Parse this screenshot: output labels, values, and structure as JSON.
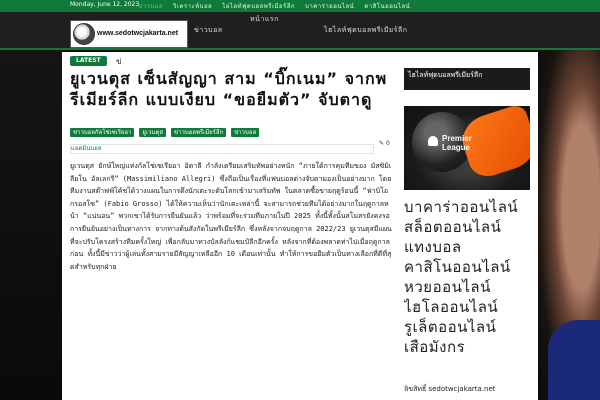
{
  "topbar": {
    "date": "Monday, June 12, 2023",
    "nav": [
      "ข่าวบอล",
      "วิเคราะห์บอล",
      "ไฮไลท์ฟุตบอลพรีเมียร์ลีก",
      "บาคาร่าออนไลน์",
      "คาสิโนออนไลน์"
    ]
  },
  "header": {
    "logo_text": "www.sedotwcjakarta.net",
    "menu": [
      "หน้าแรก",
      "ข่าวบอล",
      "ไฮไลท์ฟุตบอลพรีเมียร์ลีก"
    ]
  },
  "article": {
    "latest_label": "LATEST",
    "latest_text": "ข่",
    "title": "ยูเวนตุส เซ็นสัญญา สาม “บิ๊กเนม” จากพรีเมียร์ลีก แบบเงียบ “ขอยืมตัว” จับตาดู",
    "tags": [
      "ข่าวบอลกัลโช่เซเรียอา",
      "ยูเวนตุส",
      "ข่าวบอลพรีเมียร์ลีก",
      "ข่าวบอล"
    ],
    "author": "แอดมินบอล",
    "comments": "0",
    "body": "ยูเวนตุส ยักษ์ใหญ่แห่งกัลโช่เซเรียอา อิตาลี กำลังเตรียมเสริมทัพอย่างหนัก “ภายใต้การคุมทีมของ มัสซิมิเลียโน อัลเลกรี” (Massimiliano Allegri) ซึ่งถือเป็นเรื่องที่แฟนบอลต่างจับตามองเป็นอย่างมาก โดยทีมงานสต๊าฟฟ์โค้ชได้วางแผนในการดึงนักเตะระดับโลกเข้ามาเสริมทัพ ในตลาดซื้อขายฤดูร้อนนี้ “ฟาบิโอ กรอสโซ” (Fabio Grosso) ได้ให้ความเห็นว่านักเตะเหล่านี้ จะสามารถช่วยทีมได้อย่างมากในฤดูกาลหน้า “แน่นอน” พวกเขาได้รับการยืนยันแล้ว ว่าพร้อมที่จะร่วมทีมภายในปี 2025 ทั้งนี้ทั้งนั้นสโมสรยังคงรอการยืนยันอย่างเป็นทางการ จากทางต้นสังกัดในพรีเมียร์ลีก ซึ่งหลังจากจบฤดูกาล 2022/23 ยูเวนตุสมีแผนที่จะปรับโครงสร้างทีมครั้งใหญ่ เพื่อกลับมาทวงบัลลังก์แชมป์ลีกอีกครั้ง หลังจากที่ต้องพลาดท่าไปเมื่อฤดูกาลก่อน ทั้งนี้มีข่าวว่าผู้เล่นทั้งสามรายมีสัญญาเหลืออีก 10 เดือนเท่านั้น ทำให้การขอยืมตัวเป็นทางเลือกที่ดีที่สุดสำหรับทุกฝ่าย"
  },
  "sidebar": {
    "title": "ไฮไลท์ฟุตบอลพรีเมียร์ลีก",
    "image_caption": "Premier League",
    "list": [
      "บาคาร่าออนไลน์",
      "สล็อตออนไลน์",
      "แทงบอล",
      "คาสิโนออนไลน์",
      "หวยออนไลน์",
      "ไฮโลออนไลน์",
      "รูเล็ตออนไลน์",
      "เสือมังกร"
    ],
    "footer": "ลิขสิทธิ์ sedotwcjakarta.net"
  }
}
